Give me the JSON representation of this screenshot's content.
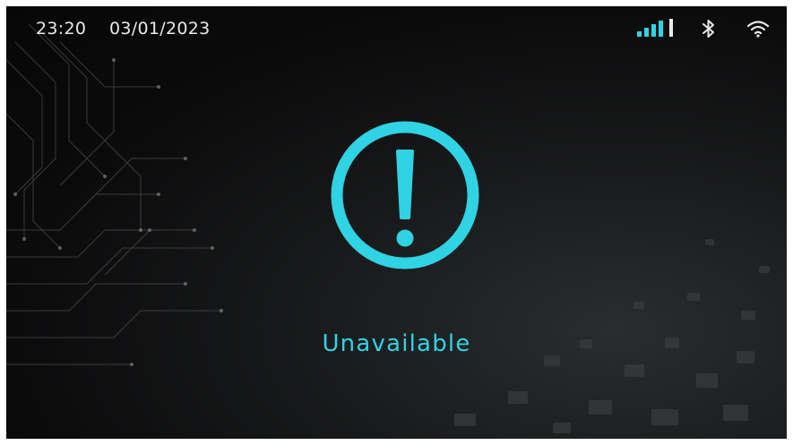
{
  "status_bar": {
    "time": "23:20",
    "date": "03/01/2023",
    "icons": [
      "cellular-signal-icon",
      "bluetooth-icon",
      "wifi-icon"
    ]
  },
  "main": {
    "icon": "exclamation-circle-icon",
    "message": "Unavailable"
  },
  "colors": {
    "accent": "#2fd3e3",
    "text": "#e9e9e9",
    "background": "#0b0b0c"
  }
}
